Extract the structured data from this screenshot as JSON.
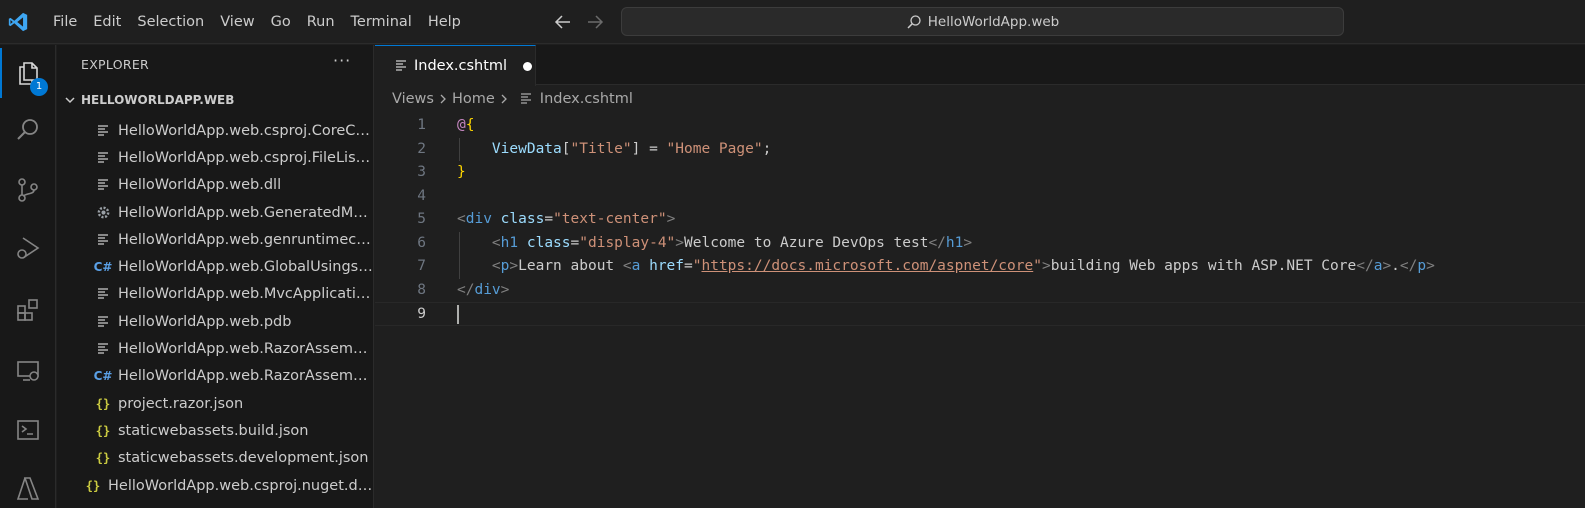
{
  "menu": [
    "File",
    "Edit",
    "Selection",
    "View",
    "Go",
    "Run",
    "Terminal",
    "Help"
  ],
  "command_center": {
    "text": "HelloWorldApp.web"
  },
  "activity_bar": {
    "explorer_badge": "1"
  },
  "sidebar": {
    "title": "EXPLORER",
    "more_label": "···",
    "section": "HELLOWORLDAPP.WEB",
    "files": [
      {
        "name": "HelloWorldApp.web.csproj.CoreCompileInputs.cache",
        "icon": "file-lines-icon"
      },
      {
        "name": "HelloWorldApp.web.csproj.FileListAbsolute.txt",
        "icon": "file-lines-icon"
      },
      {
        "name": "HelloWorldApp.web.dll",
        "icon": "file-lines-icon"
      },
      {
        "name": "HelloWorldApp.web.GeneratedMSBuildEditorConfig.editorconfig",
        "icon": "gear-icon"
      },
      {
        "name": "HelloWorldApp.web.genruntimeconfig.cache",
        "icon": "file-lines-icon"
      },
      {
        "name": "HelloWorldApp.web.GlobalUsings.g.cs",
        "icon": "csharp-icon"
      },
      {
        "name": "HelloWorldApp.web.MvcApplicationPartsAssemblyInfo.cache",
        "icon": "file-lines-icon"
      },
      {
        "name": "HelloWorldApp.web.pdb",
        "icon": "file-lines-icon"
      },
      {
        "name": "HelloWorldApp.web.RazorAssemblyInfo.cache",
        "icon": "file-lines-icon"
      },
      {
        "name": "HelloWorldApp.web.RazorAssemblyInfo.cs",
        "icon": "csharp-icon"
      },
      {
        "name": "project.razor.json",
        "icon": "json-icon"
      },
      {
        "name": "staticwebassets.build.json",
        "icon": "json-icon"
      },
      {
        "name": "staticwebassets.development.json",
        "icon": "json-icon"
      },
      {
        "name": "HelloWorldApp.web.csproj.nuget.dgspec.json",
        "icon": "json-icon"
      }
    ]
  },
  "editor": {
    "tab": {
      "label": "Index.cshtml",
      "dirty": true
    },
    "breadcrumb": [
      "Views",
      "Home",
      "Index.cshtml"
    ],
    "lines": [
      [
        {
          "t": "@",
          "c": "t-at"
        },
        {
          "t": "{",
          "c": "t-brace"
        }
      ],
      [
        {
          "t": "    "
        },
        {
          "t": "ViewData",
          "c": "t-var"
        },
        {
          "t": "[",
          "c": "t-punct"
        },
        {
          "t": "\"Title\"",
          "c": "t-str"
        },
        {
          "t": "] = ",
          "c": "t-punct"
        },
        {
          "t": "\"Home Page\"",
          "c": "t-str"
        },
        {
          "t": ";",
          "c": "t-punct"
        }
      ],
      [
        {
          "t": "}",
          "c": "t-brace"
        }
      ],
      [],
      [
        {
          "t": "<",
          "c": "t-tagb"
        },
        {
          "t": "div",
          "c": "t-tag"
        },
        {
          "t": " "
        },
        {
          "t": "class",
          "c": "t-attr"
        },
        {
          "t": "=",
          "c": "t-punct"
        },
        {
          "t": "\"text-center\"",
          "c": "t-str"
        },
        {
          "t": ">",
          "c": "t-tagb"
        }
      ],
      [
        {
          "t": "    "
        },
        {
          "t": "<",
          "c": "t-tagb"
        },
        {
          "t": "h1",
          "c": "t-tag"
        },
        {
          "t": " "
        },
        {
          "t": "class",
          "c": "t-attr"
        },
        {
          "t": "=",
          "c": "t-punct"
        },
        {
          "t": "\"display-4\"",
          "c": "t-str"
        },
        {
          "t": ">",
          "c": "t-tagb"
        },
        {
          "t": "Welcome to Azure DevOps test",
          "c": "t-text"
        },
        {
          "t": "</",
          "c": "t-tagb"
        },
        {
          "t": "h1",
          "c": "t-tag"
        },
        {
          "t": ">",
          "c": "t-tagb"
        }
      ],
      [
        {
          "t": "    "
        },
        {
          "t": "<",
          "c": "t-tagb"
        },
        {
          "t": "p",
          "c": "t-tag"
        },
        {
          "t": ">",
          "c": "t-tagb"
        },
        {
          "t": "Learn about ",
          "c": "t-text"
        },
        {
          "t": "<",
          "c": "t-tagb"
        },
        {
          "t": "a",
          "c": "t-tag"
        },
        {
          "t": " "
        },
        {
          "t": "href",
          "c": "t-attr"
        },
        {
          "t": "=",
          "c": "t-punct"
        },
        {
          "t": "\"",
          "c": "t-str"
        },
        {
          "t": "https://docs.microsoft.com/aspnet/core",
          "c": "t-link"
        },
        {
          "t": "\"",
          "c": "t-str"
        },
        {
          "t": ">",
          "c": "t-tagb"
        },
        {
          "t": "building Web apps with ASP.NET Core",
          "c": "t-text"
        },
        {
          "t": "</",
          "c": "t-tagb"
        },
        {
          "t": "a",
          "c": "t-tag"
        },
        {
          "t": ">",
          "c": "t-tagb"
        },
        {
          "t": ".",
          "c": "t-text"
        },
        {
          "t": "</",
          "c": "t-tagb"
        },
        {
          "t": "p",
          "c": "t-tag"
        },
        {
          "t": ">",
          "c": "t-tagb"
        }
      ],
      [
        {
          "t": "</",
          "c": "t-tagb"
        },
        {
          "t": "div",
          "c": "t-tag"
        },
        {
          "t": ">",
          "c": "t-tagb"
        }
      ],
      []
    ],
    "current_line": 9
  },
  "colors": {
    "accent": "#0078d4",
    "background": "#1f1f1f",
    "sidebar": "#181818"
  }
}
